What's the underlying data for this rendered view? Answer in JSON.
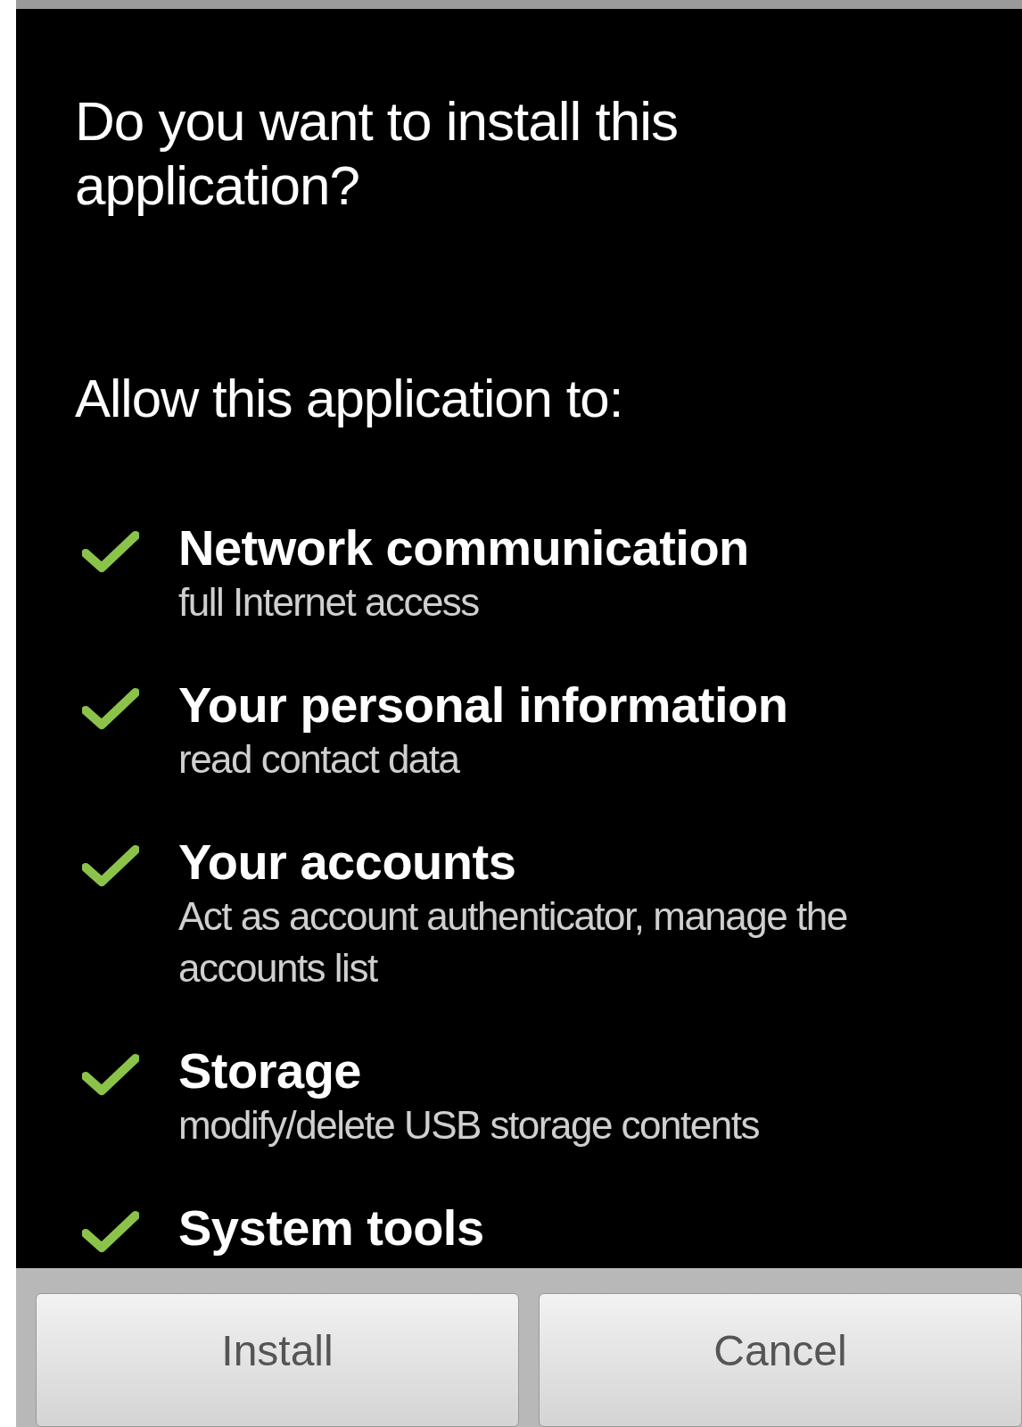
{
  "dialog": {
    "title": "Do you want to install this application?",
    "subtitle": "Allow this application to:"
  },
  "permissions": [
    {
      "name": "Network communication",
      "detail": "full Internet access"
    },
    {
      "name": "Your personal information",
      "detail": "read contact data"
    },
    {
      "name": "Your accounts",
      "detail": "Act as account authenticator, manage the accounts list"
    },
    {
      "name": "Storage",
      "detail": "modify/delete USB storage contents"
    },
    {
      "name": "System tools"
    }
  ],
  "buttons": [
    "Install",
    "Cancel"
  ]
}
